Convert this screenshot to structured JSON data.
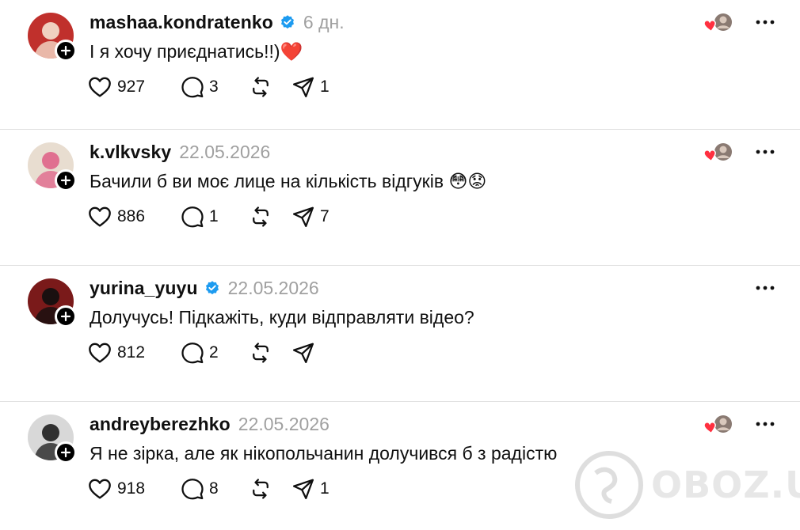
{
  "posts": [
    {
      "username": "mashaa.kondratenko",
      "verified": true,
      "timestamp": "6 дн.",
      "comment": "І я хочу приєднатись!!)❤️",
      "likes": "927",
      "replies": "3",
      "reposts": "",
      "shares": "1",
      "liked_by_author": true,
      "avatar_colors": [
        "#c0302c",
        "#f0d0c0"
      ]
    },
    {
      "username": "k.vlkvsky",
      "verified": false,
      "timestamp": "22.05.2026",
      "comment": "Бачили б ви моє лице на кількість відгуків 😳😟",
      "likes": "886",
      "replies": "1",
      "reposts": "",
      "shares": "7",
      "liked_by_author": true,
      "avatar_colors": [
        "#e8ddd0",
        "#e07090"
      ]
    },
    {
      "username": "yurina_yuyu",
      "verified": true,
      "timestamp": "22.05.2026",
      "comment": "Долучусь! Підкажіть, куди відправляти відео?",
      "likes": "812",
      "replies": "2",
      "reposts": "",
      "shares": "",
      "liked_by_author": false,
      "avatar_colors": [
        "#7a1a1a",
        "#1a1010"
      ]
    },
    {
      "username": "andreyberezhko",
      "verified": false,
      "timestamp": "22.05.2026",
      "comment": "Я не зірка, але як нікопольчанин долучився б з радістю",
      "likes": "918",
      "replies": "8",
      "reposts": "",
      "shares": "1",
      "liked_by_author": true,
      "avatar_colors": [
        "#d8d8d8",
        "#303030"
      ]
    }
  ],
  "watermark": {
    "text": "OBOZ.UA"
  },
  "icons": {
    "like": "heart-icon",
    "reply": "comment-bubble-icon",
    "repost": "repost-icon",
    "share": "send-icon",
    "more": "more-horizontal-icon",
    "verified": "verified-badge-icon",
    "follow": "plus-icon"
  },
  "colors": {
    "verified": "#1d9bf0",
    "heart": "#ff3040",
    "muted": "#a0a0a0"
  }
}
